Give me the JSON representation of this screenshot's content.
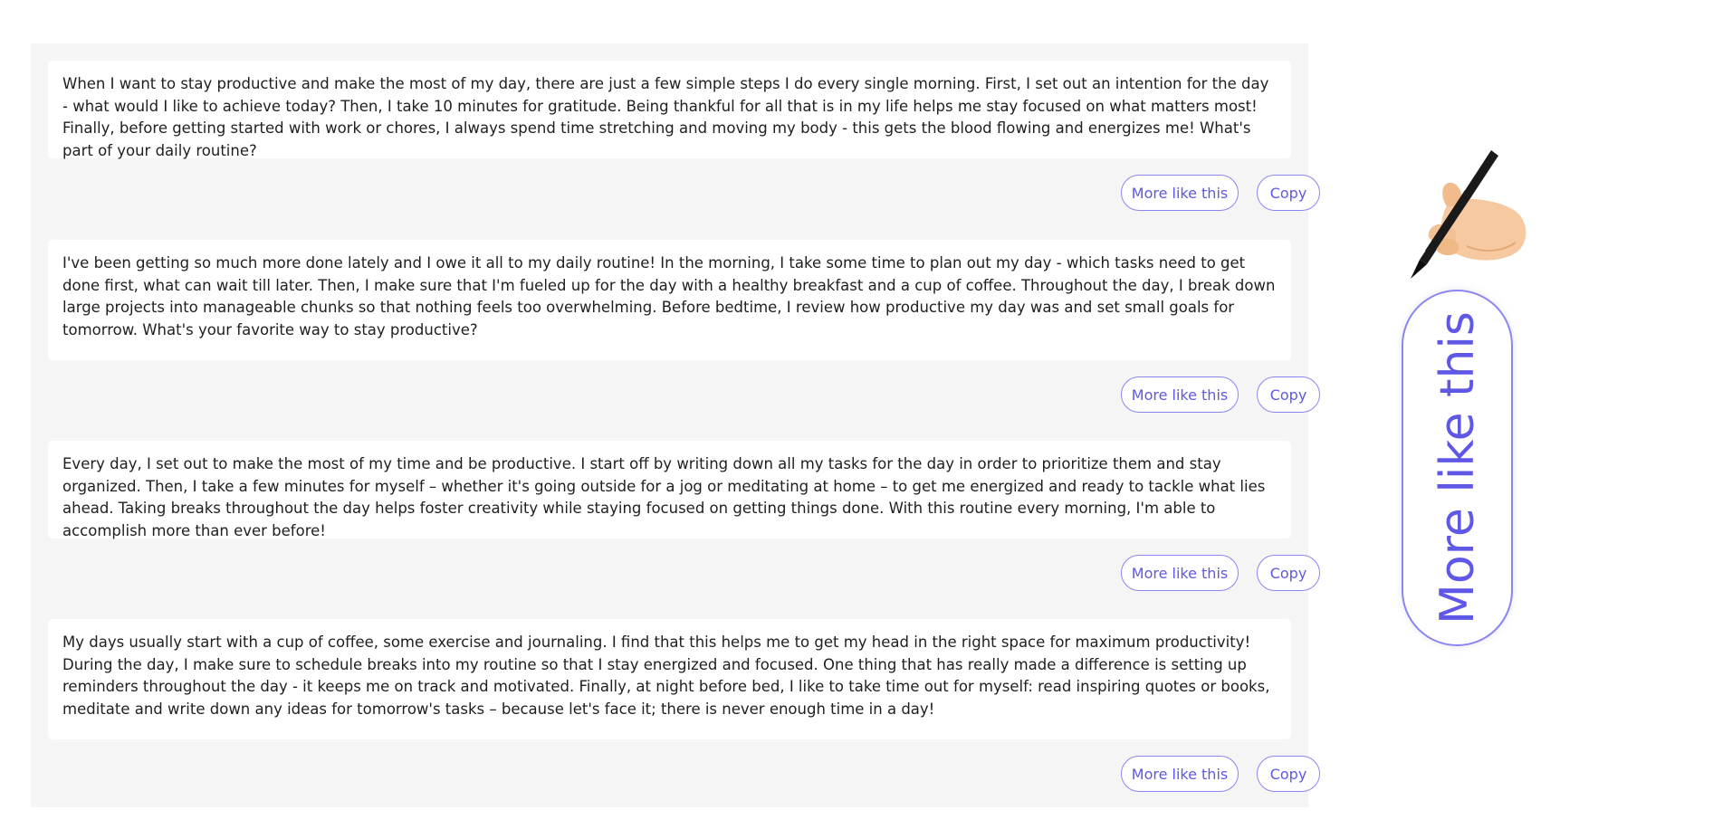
{
  "results": [
    {
      "text": "When I want to stay productive and make the most of my day, there are just a few simple steps I do every single morning. First, I set out an intention for the day - what would I like to achieve today? Then, I take 10 minutes for gratitude. Being thankful for all that is in my life helps me stay focused on what matters most! Finally, before getting started with work or chores, I always spend time stretching and moving my body - this gets the blood flowing and energizes me! What's part of your daily routine?",
      "more_label": "More like this",
      "copy_label": "Copy"
    },
    {
      "text": "I've been getting so much more done lately and I owe it all to my daily routine! In the morning, I take some time to plan out my day - which tasks need to get done first, what can wait till later. Then, I make sure that I'm fueled up for the day with a healthy breakfast and a cup of coffee. Throughout the day, I break down large projects into manageable chunks so that nothing feels too overwhelming. Before bedtime, I review how productive my day was and set small goals for tomorrow. What's your favorite way to stay productive?",
      "more_label": "More like this",
      "copy_label": "Copy"
    },
    {
      "text": "Every day, I set out to make the most of my time and be productive. I start off by writing down all my tasks for the day in order to prioritize them and stay organized. Then, I take a few minutes for myself – whether it's going outside for a jog or meditating at home – to get me energized and ready to tackle what lies ahead. Taking breaks throughout the day helps foster creativity while staying focused on getting things done. With this routine every morning, I'm able to accomplish more than ever before!",
      "more_label": "More like this",
      "copy_label": "Copy"
    },
    {
      "text": "My days usually start with a cup of coffee, some exercise and journaling. I find that this helps me to get my head in the right space for maximum productivity! During the day, I make sure to schedule breaks into my routine so that I stay energized and focused. One thing that has really made a difference is setting up reminders throughout the day - it keeps me on track and motivated. Finally, at night before bed, I like to take time out for myself: read inspiring quotes or books, meditate and write down any ideas for tomorrow's tasks – because let's face it; there is never enough time in a day!",
      "more_label": "More like this",
      "copy_label": "Copy"
    }
  ],
  "callout": {
    "icon": "writing-hand-icon",
    "button_label": "More like this"
  },
  "colors": {
    "accent": "#5f58e6",
    "accent_border": "#8a85f2",
    "panel_bg": "#f5f5f5",
    "card_bg": "#ffffff",
    "text": "#1f1f1f"
  }
}
